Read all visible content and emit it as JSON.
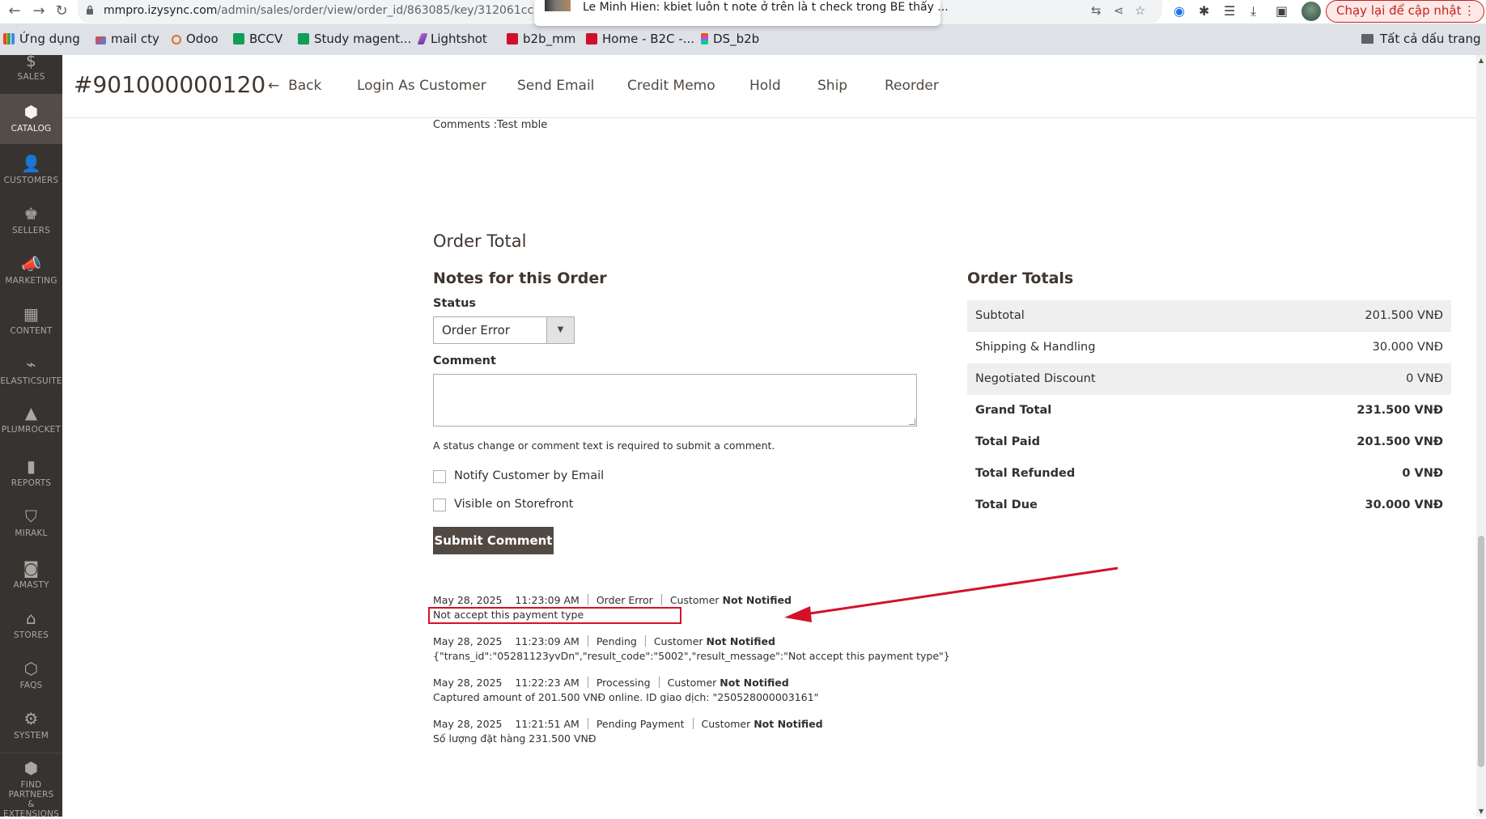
{
  "browser": {
    "url_host": "mmpro.izysync.com",
    "url_path": "/admin/sales/order/view/order_id/863085/key/312061cce5b80b",
    "notification": "Le Minh Hien: kbiet luôn t note ở trên là t check trong BE thấy ...",
    "update_button": "Chạy lại để cập nhật",
    "bookmarks": [
      "Ứng dụng",
      "mail cty",
      "Odoo",
      "BCCV",
      "Study magent...",
      "Lightshot",
      "b2b_mm",
      "Home - B2C -...",
      "DS_b2b"
    ],
    "bookmarks_right": "Tất cả dấu trang"
  },
  "sidebar": {
    "items": [
      "SALES",
      "CATALOG",
      "CUSTOMERS",
      "SELLERS",
      "MARKETING",
      "CONTENT",
      "ELASTICSUITE",
      "PLUMROCKET",
      "REPORTS",
      "MIRAKL",
      "AMASTY",
      "STORES",
      "FAQS",
      "SYSTEM",
      "FIND PARTNERS",
      "& EXTENSIONS"
    ]
  },
  "header": {
    "order_number": "#901000000120",
    "buttons": [
      "Back",
      "Login As Customer",
      "Send Email",
      "Credit Memo",
      "Hold",
      "Ship",
      "Reorder"
    ]
  },
  "main": {
    "prev_comment": "Comments :Test mble",
    "order_total_title": "Order Total",
    "notes_title": "Notes for this Order",
    "status_label": "Status",
    "status_value": "Order Error",
    "comment_label": "Comment",
    "hint": "A status change or comment text is required to submit a comment.",
    "notify_label": "Notify Customer by Email",
    "visible_label": "Visible on Storefront",
    "submit_label": "Submit Comment"
  },
  "totals": {
    "title": "Order Totals",
    "rows": [
      {
        "label": "Subtotal",
        "value": "201.500 VNĐ"
      },
      {
        "label": "Shipping & Handling",
        "value": "30.000 VNĐ"
      },
      {
        "label": "Negotiated Discount",
        "value": "0 VNĐ"
      },
      {
        "label": "Grand Total",
        "value": "231.500 VNĐ"
      },
      {
        "label": "Total Paid",
        "value": "201.500 VNĐ"
      },
      {
        "label": "Total Refunded",
        "value": "0 VNĐ"
      },
      {
        "label": "Total Due",
        "value": "30.000 VNĐ"
      }
    ]
  },
  "history": [
    {
      "date": "May 28, 2025",
      "time": "11:23:09 AM",
      "status": "Order Error",
      "customer": "Customer",
      "notified": "Not Notified",
      "message": "Not accept this payment type"
    },
    {
      "date": "May 28, 2025",
      "time": "11:23:09 AM",
      "status": "Pending",
      "customer": "Customer",
      "notified": "Not Notified",
      "message": "{\"trans_id\":\"05281123yvDn\",\"result_code\":\"5002\",\"result_message\":\"Not accept this payment type\"}"
    },
    {
      "date": "May 28, 2025",
      "time": "11:22:23 AM",
      "status": "Processing",
      "customer": "Customer",
      "notified": "Not Notified",
      "message": "Captured amount of 201.500  VNĐ online. ID giao dịch: \"250528000003161\""
    },
    {
      "date": "May 28, 2025",
      "time": "11:21:51 AM",
      "status": "Pending Payment",
      "customer": "Customer",
      "notified": "Not Notified",
      "message": "Số lượng đặt hàng 231.500  VNĐ"
    }
  ]
}
